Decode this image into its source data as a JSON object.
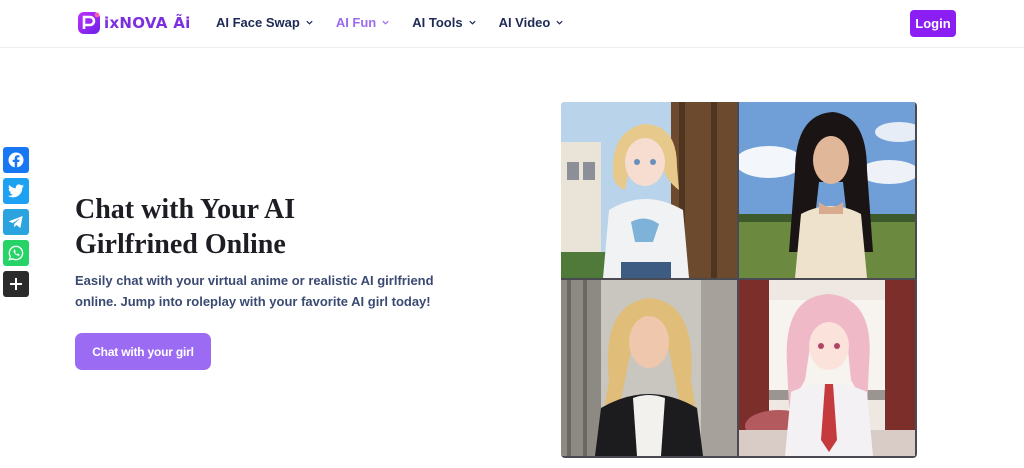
{
  "brand": {
    "name": "PixNova",
    "logo_text": "ixNOVA Ãi"
  },
  "nav": {
    "items": [
      {
        "label": "AI Face Swap",
        "active": false
      },
      {
        "label": "AI Fun",
        "active": true
      },
      {
        "label": "AI Tools",
        "active": false
      },
      {
        "label": "AI Video",
        "active": false
      }
    ]
  },
  "header": {
    "login_label": "Login"
  },
  "share": {
    "items": [
      "facebook-icon",
      "twitter-icon",
      "telegram-icon",
      "whatsapp-icon",
      "plus-icon"
    ],
    "colors": {
      "facebook": "#1877f2",
      "twitter": "#1da1f2",
      "telegram": "#2aa3de",
      "whatsapp": "#25d366",
      "more": "#2b2b2b"
    }
  },
  "hero": {
    "title_line1": "Chat with Your AI",
    "title_line2": "Girlfrined Online",
    "subtitle_line1": "Easily chat with your virtual anime or realistic AI girlfriend",
    "subtitle_line2": "online. Jump into roleplay with your favorite AI girl today!",
    "cta_label": "Chat with your girl"
  },
  "colors": {
    "accent": "#8b1ef2",
    "cta": "#9b6bf4",
    "nav_active": "#9b6bf0",
    "nav_text": "#1e2a55"
  }
}
